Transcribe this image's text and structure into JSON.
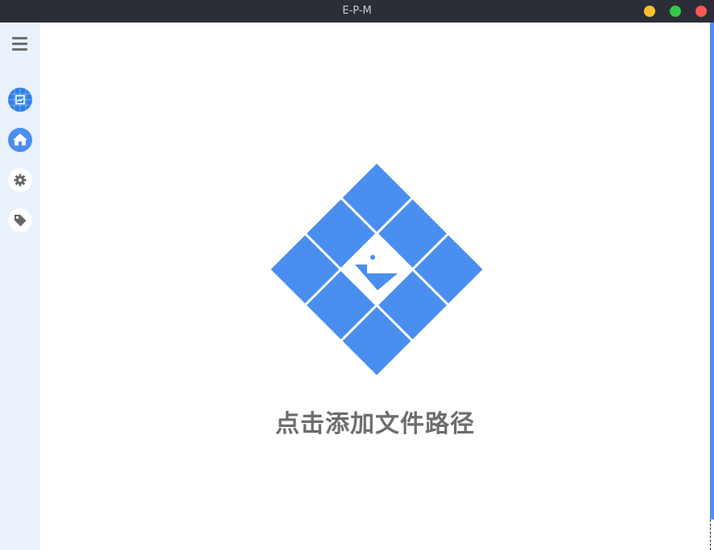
{
  "window": {
    "title": "E-P-M",
    "controls": [
      "minimize",
      "maximize",
      "close"
    ]
  },
  "sidebar": {
    "menu_icon": "hamburger-menu-icon",
    "items": [
      {
        "id": "dashboard",
        "icon": "dashboard-chart-icon",
        "state": "active"
      },
      {
        "id": "home",
        "icon": "home-icon",
        "state": "normal"
      },
      {
        "id": "settings",
        "icon": "gear-icon",
        "state": "normal"
      },
      {
        "id": "tags",
        "icon": "tag-icon",
        "state": "normal"
      }
    ]
  },
  "main": {
    "logo_icon": "diamond-tile-logo-icon",
    "add_path_label": "点击添加文件路径"
  },
  "colors": {
    "titlebar": "#2b2e37",
    "sidebar": "#e8f1fc",
    "accent": "#4a8ef0",
    "label": "#6d6d6d"
  }
}
